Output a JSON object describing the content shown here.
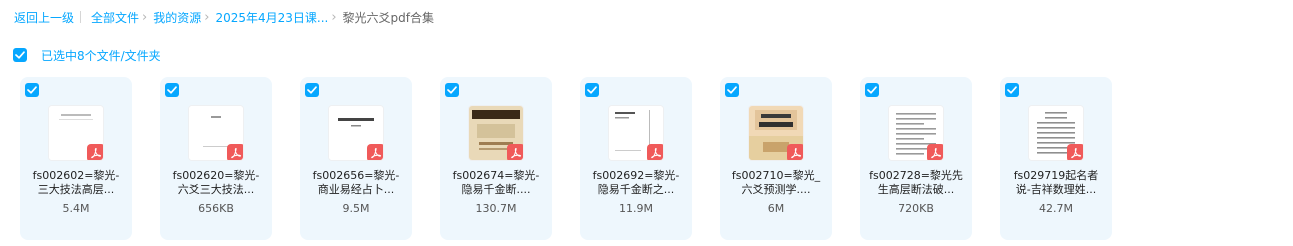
{
  "breadcrumb": {
    "items": [
      "返回上一级",
      "全部文件",
      "我的资源",
      "2025年4月23日课..."
    ],
    "current": "黎光六爻pdf合集"
  },
  "selection": {
    "label": "已选中8个文件/文件夹"
  },
  "colors": {
    "accent": "#06a7ff",
    "card_bg": "#eef7fd",
    "pdf_badge": "#f05a5a"
  },
  "files": [
    {
      "name_line1": "fs002602=黎光-",
      "name_line2": "三大技法高层...",
      "size": "5.4M",
      "thumb": "doc-light",
      "checked": true
    },
    {
      "name_line1": "fs002620=黎光-",
      "name_line2": "六爻三大技法...",
      "size": "656KB",
      "thumb": "doc-blank",
      "checked": true
    },
    {
      "name_line1": "fs002656=黎光-",
      "name_line2": "商业易经占卜...",
      "size": "9.5M",
      "thumb": "doc-title",
      "checked": true
    },
    {
      "name_line1": "fs002674=黎光-",
      "name_line2": "隐易千金断....",
      "size": "130.7M",
      "thumb": "scan-old",
      "checked": true
    },
    {
      "name_line1": "fs002692=黎光-",
      "name_line2": "隐易千金断之...",
      "size": "11.9M",
      "thumb": "doc-lined",
      "checked": true
    },
    {
      "name_line1": "fs002710=黎光_",
      "name_line2": "六爻预测学....",
      "size": "6M",
      "thumb": "book-cover",
      "checked": true
    },
    {
      "name_line1": "fs002728=黎光先",
      "name_line2": "生高层断法破...",
      "size": "720KB",
      "thumb": "doc-text",
      "checked": true
    },
    {
      "name_line1": "fs029719起名者",
      "name_line2": "说-吉祥数理姓...",
      "size": "42.7M",
      "thumb": "doc-text2",
      "checked": true
    }
  ]
}
